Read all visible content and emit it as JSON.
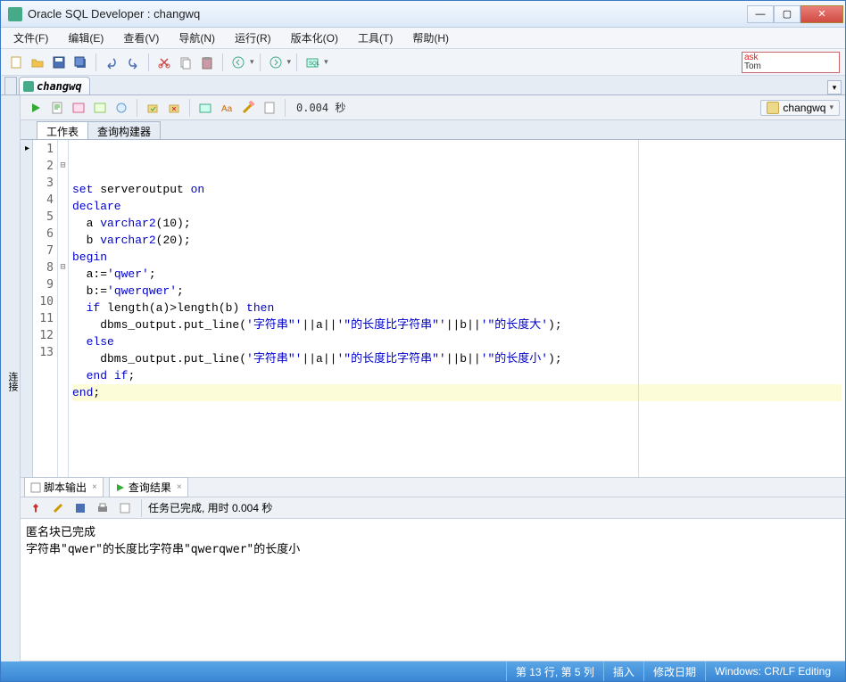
{
  "title": "Oracle SQL Developer : changwq",
  "menu": [
    "文件(F)",
    "编辑(E)",
    "查看(V)",
    "导航(N)",
    "运行(R)",
    "版本化(O)",
    "工具(T)",
    "帮助(H)"
  ],
  "ask": {
    "line1": "ask",
    "line2": "Tom"
  },
  "doctab": "changwq",
  "toolbar_timing": "0.004 秒",
  "connection": "changwq",
  "worksheet_tabs": {
    "active": "工作表",
    "other": "查询构建器"
  },
  "code": {
    "lines": [
      {
        "n": 1,
        "fold": "",
        "html": "<span class='kw'>set</span> serveroutput <span class='kw'>on</span>"
      },
      {
        "n": 2,
        "fold": "⊟",
        "html": "<span class='kw'>declare</span>"
      },
      {
        "n": 3,
        "fold": "",
        "html": "  a <span class='kw'>varchar2</span>(10);"
      },
      {
        "n": 4,
        "fold": "",
        "html": "  b <span class='kw'>varchar2</span>(20);"
      },
      {
        "n": 5,
        "fold": "",
        "html": "<span class='kw'>begin</span>"
      },
      {
        "n": 6,
        "fold": "",
        "html": "  a:=<span class='str'>'qwer'</span>;"
      },
      {
        "n": 7,
        "fold": "",
        "html": "  b:=<span class='str'>'qwerqwer'</span>;"
      },
      {
        "n": 8,
        "fold": "⊟",
        "html": "  <span class='kw'>if</span> length(a)&gt;length(b) <span class='kw'>then</span>"
      },
      {
        "n": 9,
        "fold": "",
        "html": "    dbms_output.put_line(<span class='str'>'字符串\"'</span>||a||<span class='str'>'\"的长度比字符串\"'</span>||b||<span class='str'>'\"的长度大'</span>);"
      },
      {
        "n": 10,
        "fold": "",
        "html": "  <span class='kw'>else</span>"
      },
      {
        "n": 11,
        "fold": "",
        "html": "    dbms_output.put_line(<span class='str'>'字符串\"'</span>||a||<span class='str'>'\"的长度比字符串\"'</span>||b||<span class='str'>'\"的长度小'</span>);"
      },
      {
        "n": 12,
        "fold": "",
        "html": "  <span class='kw'>end</span> <span class='kw'>if</span>;"
      },
      {
        "n": 13,
        "fold": "",
        "html": "<span class='kw'>end</span>;",
        "hl": true
      }
    ]
  },
  "output_tabs": {
    "script": "脚本输出",
    "results": "查询结果"
  },
  "output_bar": "任务已完成, 用时 0.004 秒",
  "output_text": "匿名块已完成\n字符串\"qwer\"的长度比字符串\"qwerqwer\"的长度小",
  "status": {
    "pos": "第 13 行, 第 5 列",
    "ins": "插入",
    "mod": "修改日期",
    "enc": "Windows: CR/LF Editing"
  }
}
